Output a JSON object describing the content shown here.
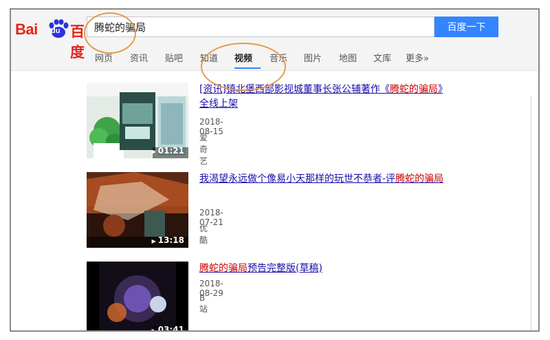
{
  "logo": {
    "bai": "Bai",
    "du": "du",
    "cn": "百度"
  },
  "search": {
    "query": "腾蛇的骗局",
    "button": "百度一下"
  },
  "tabs": [
    "网页",
    "资讯",
    "贴吧",
    "知道",
    "视频",
    "音乐",
    "图片",
    "地图",
    "文库",
    "更多»"
  ],
  "active_tab": "视频",
  "results": [
    {
      "title_pre": "[资讯]镇北堡西部影视城董事长张公辅著作《",
      "title_hl1": "腾蛇的",
      "title_mid": "",
      "title_hl2": "骗局",
      "title_post": "》全线上架",
      "date": "2018-08-15",
      "source": "爱奇艺",
      "duration": "01:21",
      "colors": {
        "bg": "#dfe6e0",
        "accent": "#3fa34a"
      }
    },
    {
      "title_pre": "我渴望永远做个像易小天那样的玩世不恭者-评",
      "title_hl1": "腾蛇",
      "title_mid": "",
      "title_hl2": "的骗局",
      "title_post": "",
      "date": "2018-07-21",
      "source": "优酷",
      "duration": "13:18",
      "colors": {
        "bg": "#3a1d12",
        "accent": "#e8632a"
      }
    },
    {
      "title_pre": "",
      "title_hl1": "腾蛇的骗局",
      "title_mid": "",
      "title_hl2": "",
      "title_post": "预告完整版(草稿)",
      "date": "2018-08-29",
      "source": "B站",
      "duration": "03:41",
      "colors": {
        "bg": "#1c1424",
        "accent": "#7a5cc8"
      }
    }
  ],
  "colors": {
    "brand": "#e1261c",
    "button": "#3385ff",
    "link": "#1a0dab",
    "highlight": "#cc0000",
    "annotation": "#e59a4a"
  }
}
